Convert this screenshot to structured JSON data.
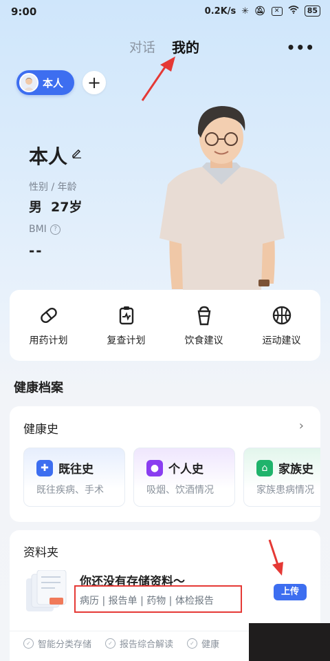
{
  "status_bar": {
    "time": "9:00",
    "net_speed": "0.2K/s",
    "battery": "85"
  },
  "tabs": [
    {
      "label": "对话"
    },
    {
      "label": "我的"
    }
  ],
  "profile": {
    "chip_label": "本人",
    "name": "本人",
    "gender_age_label": "性别 / 年龄",
    "gender": "男",
    "age": "27岁",
    "bmi_label": "BMI",
    "bmi_value": "--"
  },
  "quick_actions": [
    {
      "label": "用药计划",
      "icon": "pill-icon"
    },
    {
      "label": "复查计划",
      "icon": "clipboard-pulse-icon"
    },
    {
      "label": "饮食建议",
      "icon": "drink-cup-icon"
    },
    {
      "label": "运动建议",
      "icon": "basketball-icon"
    }
  ],
  "health_section_title": "健康档案",
  "history": {
    "title": "健康史",
    "tiles": [
      {
        "title": "既往史",
        "subtitle": "既往疾病、手术",
        "color": "#3d6ef0"
      },
      {
        "title": "个人史",
        "subtitle": "吸烟、饮酒情况",
        "color": "#8a3df0"
      },
      {
        "title": "家族史",
        "subtitle": "家族患病情况",
        "color": "#1fb36b"
      }
    ]
  },
  "folder": {
    "title": "资料夹",
    "empty_text": "你还没有存储资料～",
    "categories": "病历 | 报告单 | 药物 | 体检报告",
    "upload_label": "上传",
    "features": [
      "智能分类存储",
      "报告综合解读",
      "健康"
    ]
  }
}
